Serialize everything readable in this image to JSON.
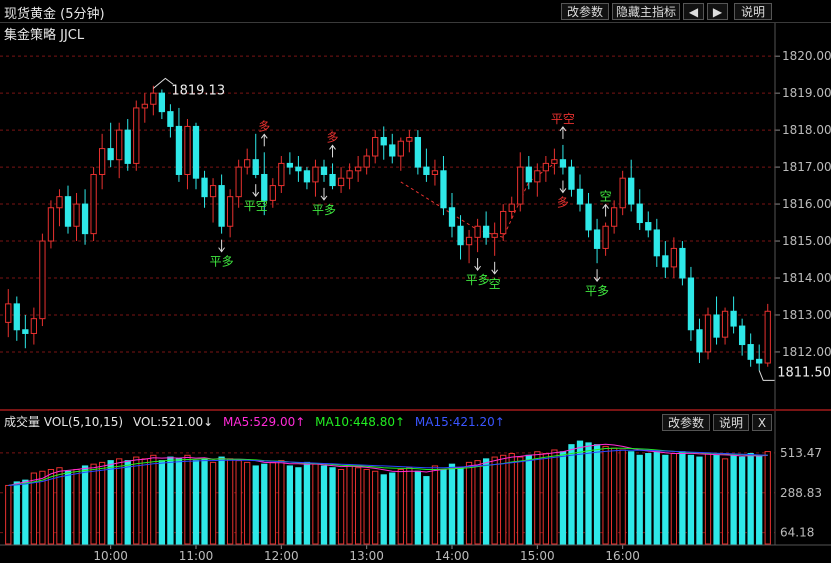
{
  "header": {
    "title": "现货黄金 (5分钟)",
    "strategy": "集金策略 JJCL",
    "buttons": {
      "params": "改参数",
      "hide": "隐藏主指标",
      "left": "◀",
      "right": "▶",
      "help": "说明"
    }
  },
  "colors": {
    "up": "#e8312f",
    "down": "#2ee8e8",
    "grid": "#7a1414",
    "ma5": "#ff2bd8",
    "ma10": "#22ee22",
    "ma15": "#2a45ff"
  },
  "volume_header": {
    "name": "成交量 VOL(5,10,15)",
    "vol": "VOL:521.00↓",
    "ma5": "MA5:529.00↑",
    "ma10": "MA10:448.80↑",
    "ma15": "MA15:421.20↑",
    "buttons": {
      "params": "改参数",
      "help": "说明",
      "close": "X"
    }
  },
  "chart_data": [
    {
      "type": "candlestick",
      "y_ticks": [
        "1820.00",
        "1819.00",
        "1818.00",
        "1817.00",
        "1816.00",
        "1815.00",
        "1814.00",
        "1813.00",
        "1812.00"
      ],
      "ylim": [
        1810.7,
        1820.6
      ],
      "x_ticks": [
        "10:00",
        "11:00",
        "12:00",
        "13:00",
        "14:00",
        "15:00",
        "16:00"
      ],
      "grid": "horizontal dashed",
      "annotations": {
        "high": "1819.13",
        "low": "1811.50"
      },
      "signals": [
        {
          "bar": 25,
          "text": "平多",
          "arrow": "down",
          "kind": "long"
        },
        {
          "bar": 29,
          "text": "平空",
          "arrow": "down",
          "kind": "long"
        },
        {
          "bar": 30,
          "text": "多",
          "arrow": "up",
          "kind": "short"
        },
        {
          "bar": 37,
          "text": "平多",
          "arrow": "down",
          "kind": "long"
        },
        {
          "bar": 38,
          "text": "多",
          "arrow": "up",
          "kind": "short"
        },
        {
          "bar": 55,
          "text": "平多",
          "arrow": "down",
          "kind": "long"
        },
        {
          "bar": 57,
          "text": "空",
          "arrow": "down",
          "kind": "long"
        },
        {
          "bar": 65,
          "text": "多",
          "arrow": "down",
          "kind": "short"
        },
        {
          "bar": 65,
          "text": "平空",
          "arrow": "up",
          "kind": "short"
        },
        {
          "bar": 69,
          "text": "平多",
          "arrow": "down",
          "kind": "long"
        },
        {
          "bar": 70,
          "text": "空",
          "arrow": "up",
          "kind": "long"
        }
      ],
      "candles": [
        [
          1812.8,
          1813.7,
          1812.4,
          1813.3
        ],
        [
          1813.3,
          1813.5,
          1812.3,
          1812.6
        ],
        [
          1812.6,
          1813.0,
          1812.1,
          1812.5
        ],
        [
          1812.5,
          1813.2,
          1812.2,
          1812.9
        ],
        [
          1812.9,
          1815.2,
          1812.7,
          1815.0
        ],
        [
          1815.0,
          1816.1,
          1814.8,
          1815.9
        ],
        [
          1815.9,
          1816.4,
          1815.4,
          1816.2
        ],
        [
          1816.2,
          1816.5,
          1815.2,
          1815.4
        ],
        [
          1815.4,
          1816.3,
          1815.0,
          1816.0
        ],
        [
          1816.0,
          1816.4,
          1814.9,
          1815.2
        ],
        [
          1815.2,
          1817.0,
          1815.0,
          1816.8
        ],
        [
          1816.8,
          1817.9,
          1816.4,
          1817.5
        ],
        [
          1817.5,
          1818.2,
          1817.0,
          1817.2
        ],
        [
          1817.2,
          1818.2,
          1816.7,
          1818.0
        ],
        [
          1818.0,
          1818.3,
          1816.9,
          1817.1
        ],
        [
          1817.1,
          1818.8,
          1816.9,
          1818.6
        ],
        [
          1818.6,
          1819.0,
          1818.2,
          1818.7
        ],
        [
          1818.7,
          1819.2,
          1818.4,
          1819.0
        ],
        [
          1819.0,
          1819.1,
          1818.3,
          1818.5
        ],
        [
          1818.5,
          1818.7,
          1817.8,
          1818.1
        ],
        [
          1818.1,
          1818.6,
          1816.6,
          1816.8
        ],
        [
          1816.8,
          1818.3,
          1816.4,
          1818.1
        ],
        [
          1818.1,
          1818.2,
          1816.4,
          1816.7
        ],
        [
          1816.7,
          1816.9,
          1815.9,
          1816.2
        ],
        [
          1816.2,
          1816.7,
          1815.5,
          1816.5
        ],
        [
          1816.5,
          1816.8,
          1815.2,
          1815.4
        ],
        [
          1815.4,
          1816.4,
          1815.1,
          1816.2
        ],
        [
          1816.2,
          1817.2,
          1815.9,
          1817.0
        ],
        [
          1817.0,
          1817.5,
          1816.8,
          1817.2
        ],
        [
          1817.2,
          1817.9,
          1816.7,
          1816.8
        ],
        [
          1816.8,
          1817.4,
          1815.7,
          1816.1
        ],
        [
          1816.1,
          1816.7,
          1815.9,
          1816.5
        ],
        [
          1816.5,
          1817.3,
          1816.3,
          1817.1
        ],
        [
          1817.1,
          1817.4,
          1816.8,
          1817.0
        ],
        [
          1817.0,
          1817.3,
          1816.6,
          1816.9
        ],
        [
          1816.9,
          1817.0,
          1816.4,
          1816.6
        ],
        [
          1816.6,
          1817.2,
          1816.2,
          1817.0
        ],
        [
          1817.0,
          1817.2,
          1816.6,
          1816.8
        ],
        [
          1816.8,
          1817.1,
          1816.4,
          1816.5
        ],
        [
          1816.5,
          1817.0,
          1816.3,
          1816.7
        ],
        [
          1816.7,
          1817.1,
          1816.4,
          1816.9
        ],
        [
          1816.9,
          1817.3,
          1816.6,
          1817.0
        ],
        [
          1817.0,
          1817.5,
          1816.8,
          1817.3
        ],
        [
          1817.3,
          1818.0,
          1817.1,
          1817.8
        ],
        [
          1817.8,
          1818.1,
          1817.2,
          1817.6
        ],
        [
          1817.6,
          1817.9,
          1817.1,
          1817.3
        ],
        [
          1817.3,
          1817.8,
          1816.9,
          1817.7
        ],
        [
          1817.7,
          1818.0,
          1817.4,
          1817.8
        ],
        [
          1817.8,
          1818.0,
          1816.8,
          1817.0
        ],
        [
          1817.0,
          1817.5,
          1816.6,
          1816.8
        ],
        [
          1816.8,
          1817.2,
          1816.5,
          1816.9
        ],
        [
          1816.9,
          1817.3,
          1815.7,
          1815.9
        ],
        [
          1815.9,
          1816.3,
          1815.1,
          1815.4
        ],
        [
          1815.4,
          1815.7,
          1814.5,
          1814.9
        ],
        [
          1814.9,
          1815.3,
          1814.4,
          1815.1
        ],
        [
          1815.1,
          1815.6,
          1814.7,
          1815.4
        ],
        [
          1815.4,
          1815.8,
          1814.9,
          1815.1
        ],
        [
          1815.1,
          1815.5,
          1814.6,
          1815.2
        ],
        [
          1815.2,
          1816.0,
          1815.0,
          1815.8
        ],
        [
          1815.8,
          1816.2,
          1815.6,
          1816.0
        ],
        [
          1816.0,
          1817.4,
          1815.8,
          1817.0
        ],
        [
          1817.0,
          1817.3,
          1816.4,
          1816.6
        ],
        [
          1816.6,
          1817.1,
          1816.2,
          1816.9
        ],
        [
          1816.9,
          1817.3,
          1816.6,
          1817.1
        ],
        [
          1817.1,
          1817.5,
          1816.8,
          1817.2
        ],
        [
          1817.2,
          1817.6,
          1816.8,
          1817.0
        ],
        [
          1817.0,
          1817.2,
          1816.2,
          1816.4
        ],
        [
          1816.4,
          1816.8,
          1815.8,
          1816.0
        ],
        [
          1816.0,
          1816.3,
          1815.1,
          1815.3
        ],
        [
          1815.3,
          1815.6,
          1814.4,
          1814.8
        ],
        [
          1814.8,
          1815.5,
          1814.6,
          1815.4
        ],
        [
          1815.4,
          1816.1,
          1815.2,
          1815.9
        ],
        [
          1815.9,
          1816.9,
          1815.7,
          1816.7
        ],
        [
          1816.7,
          1817.2,
          1815.8,
          1816.0
        ],
        [
          1816.0,
          1816.4,
          1815.3,
          1815.5
        ],
        [
          1815.5,
          1815.8,
          1815.1,
          1815.3
        ],
        [
          1815.3,
          1815.6,
          1814.3,
          1814.6
        ],
        [
          1814.6,
          1815.0,
          1814.0,
          1814.3
        ],
        [
          1814.3,
          1815.1,
          1814.0,
          1814.8
        ],
        [
          1814.8,
          1815.0,
          1813.8,
          1814.0
        ],
        [
          1814.0,
          1814.3,
          1812.3,
          1812.6
        ],
        [
          1812.6,
          1812.9,
          1811.7,
          1812.0
        ],
        [
          1812.0,
          1813.2,
          1811.8,
          1813.0
        ],
        [
          1813.0,
          1813.5,
          1812.2,
          1812.4
        ],
        [
          1812.4,
          1813.2,
          1812.2,
          1813.1
        ],
        [
          1813.1,
          1813.5,
          1812.5,
          1812.7
        ],
        [
          1812.7,
          1812.9,
          1811.9,
          1812.2
        ],
        [
          1812.2,
          1812.5,
          1811.6,
          1811.8
        ],
        [
          1811.8,
          1812.2,
          1811.5,
          1811.7
        ],
        [
          1811.7,
          1813.3,
          1811.6,
          1813.1
        ]
      ]
    },
    {
      "type": "bar",
      "y_ticks": [
        "513.47",
        "288.83",
        "64.18"
      ],
      "ylim": [
        0,
        620
      ],
      "series": [
        {
          "name": "VOL",
          "values": [
            330,
            350,
            360,
            400,
            410,
            420,
            430,
            410,
            420,
            440,
            450,
            460,
            470,
            480,
            470,
            490,
            480,
            500,
            470,
            490,
            480,
            500,
            470,
            480,
            460,
            490,
            480,
            470,
            460,
            440,
            450,
            460,
            470,
            440,
            430,
            460,
            450,
            440,
            430,
            420,
            440,
            430,
            420,
            410,
            390,
            400,
            420,
            430,
            410,
            380,
            440,
            420,
            450,
            430,
            460,
            470,
            480,
            490,
            500,
            510,
            490,
            500,
            520,
            510,
            530,
            520,
            560,
            580,
            570,
            560,
            550,
            540,
            530,
            520,
            500,
            510,
            520,
            500,
            510,
            520,
            500,
            490,
            510,
            500,
            480,
            500,
            490,
            510,
            500,
            521
          ]
        },
        {
          "name": "MA5",
          "values": [
            330,
            340,
            350,
            360,
            370,
            395,
            410,
            415,
            420,
            426,
            430,
            438,
            448,
            458,
            466,
            474,
            478,
            486,
            484,
            486,
            484,
            488,
            484,
            486,
            478,
            482,
            478,
            478,
            476,
            470,
            460,
            458,
            458,
            452,
            452,
            450,
            452,
            446,
            442,
            436,
            438,
            436,
            432,
            426,
            418,
            410,
            408,
            410,
            410,
            406,
            414,
            420,
            426,
            430,
            440,
            446,
            458,
            470,
            480,
            490,
            494,
            500,
            504,
            508,
            514,
            520,
            532,
            544,
            552,
            558,
            562,
            558,
            550,
            540,
            530,
            524,
            520,
            514,
            510,
            510,
            512,
            508,
            506,
            504,
            502,
            500,
            496,
            498,
            496,
            500
          ]
        },
        {
          "name": "MA10",
          "values": [
            330,
            335,
            342,
            350,
            360,
            378,
            392,
            402,
            408,
            414,
            420,
            426,
            432,
            438,
            444,
            452,
            458,
            464,
            468,
            472,
            474,
            476,
            478,
            480,
            478,
            480,
            478,
            478,
            476,
            474,
            470,
            468,
            466,
            462,
            458,
            456,
            454,
            452,
            448,
            444,
            442,
            440,
            438,
            434,
            430,
            428,
            426,
            426,
            424,
            420,
            420,
            422,
            424,
            426,
            430,
            436,
            442,
            448,
            454,
            462,
            468,
            474,
            482,
            490,
            496,
            502,
            510,
            518,
            526,
            532,
            538,
            540,
            540,
            538,
            536,
            534,
            530,
            526,
            522,
            518,
            516,
            514,
            512,
            510,
            508,
            506,
            504,
            502,
            500,
            500
          ]
        },
        {
          "name": "MA15",
          "values": [
            330,
            333,
            338,
            345,
            352,
            366,
            378,
            388,
            396,
            404,
            410,
            416,
            422,
            428,
            434,
            440,
            446,
            452,
            456,
            460,
            464,
            466,
            468,
            470,
            470,
            472,
            472,
            472,
            472,
            470,
            468,
            466,
            464,
            462,
            460,
            458,
            456,
            454,
            452,
            450,
            448,
            446,
            444,
            442,
            440,
            438,
            436,
            434,
            432,
            430,
            430,
            430,
            432,
            434,
            436,
            440,
            444,
            448,
            452,
            458,
            464,
            470,
            476,
            482,
            488,
            494,
            500,
            506,
            512,
            518,
            522,
            526,
            528,
            528,
            528,
            528,
            526,
            524,
            522,
            520,
            518,
            516,
            514,
            512,
            510,
            508,
            506,
            504,
            502,
            500
          ]
        }
      ]
    }
  ]
}
